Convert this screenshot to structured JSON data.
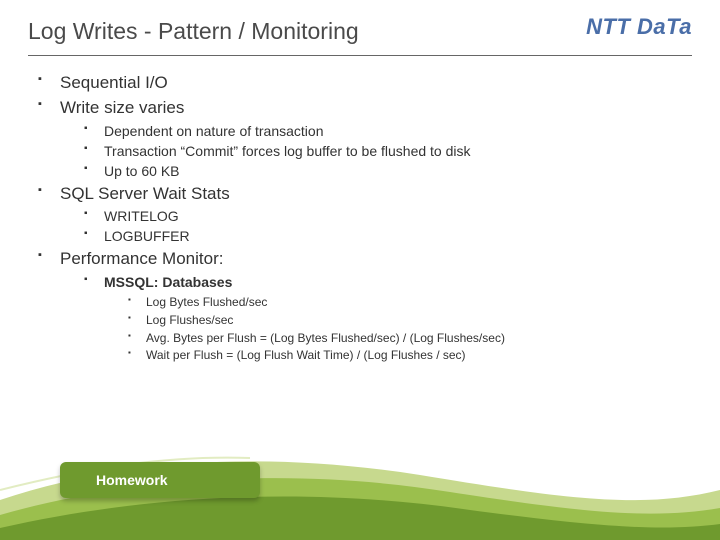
{
  "header": {
    "title": "Log Writes - Pattern / Monitoring",
    "logo": "NTT DaTa"
  },
  "bullets": {
    "b1": "Sequential I/O",
    "b2": "Write size varies",
    "b2_1": "Dependent on nature of transaction",
    "b2_2": "Transaction “Commit” forces log buffer to be flushed to disk",
    "b2_3": "Up to 60 KB",
    "b3": "SQL Server Wait Stats",
    "b3_1": "WRITELOG",
    "b3_2": "LOGBUFFER",
    "b4": "Performance Monitor:",
    "b4_1": "MSSQL: Databases",
    "b4_1_1": "Log Bytes Flushed/sec",
    "b4_1_2": "Log Flushes/sec",
    "b4_1_3": "Avg. Bytes per Flush = (Log Bytes Flushed/sec) / (Log Flushes/sec)",
    "b4_1_4": "Wait per Flush = (Log Flush Wait Time) / (Log Flushes / sec)"
  },
  "banner": {
    "label": "Homework"
  }
}
